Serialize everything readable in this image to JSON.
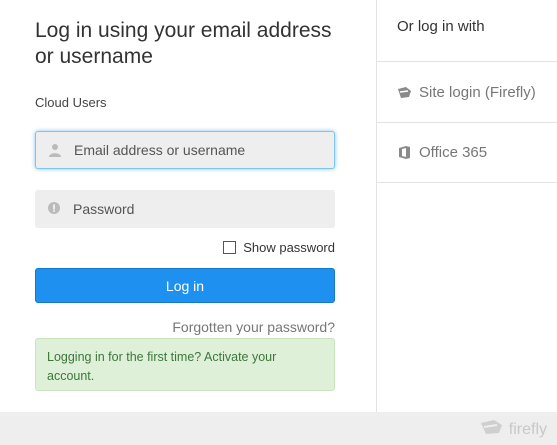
{
  "login": {
    "heading": "Log in using your email address or username",
    "subheading": "Cloud Users",
    "email_placeholder": "Email address or username",
    "password_placeholder": "Password",
    "show_password_label": "Show password",
    "login_button": "Log in",
    "forgot_link": "Forgotten your password?",
    "first_time_text": "Logging in for the first time? ",
    "activate_link": "Activate your account."
  },
  "sidebar": {
    "title": "Or log in with",
    "options": [
      {
        "label": "Site login (Firefly)",
        "icon": "firefly-icon"
      },
      {
        "label": "Office 365",
        "icon": "office-icon"
      }
    ]
  },
  "footer": {
    "brand": "firefly"
  },
  "colors": {
    "primary_button": "#1e90f0",
    "focus_glow": "#7ec6f0",
    "notice_bg": "#dff0d8",
    "notice_text": "#3c763d"
  }
}
